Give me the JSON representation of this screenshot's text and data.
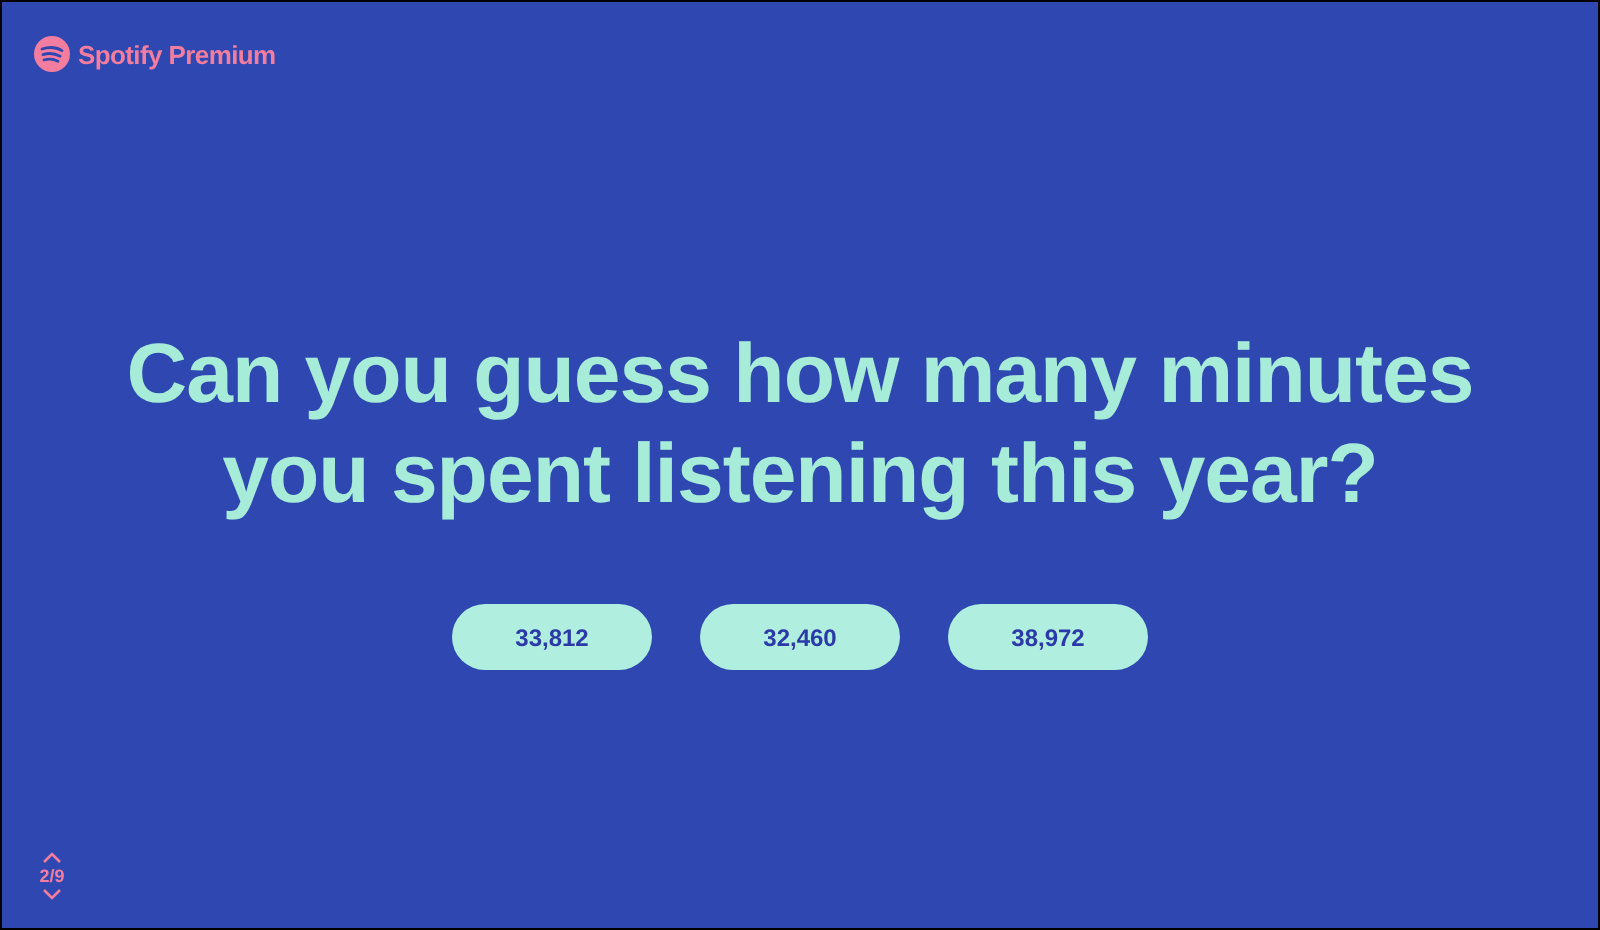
{
  "brand": {
    "name": "Spotify",
    "tier": "Premium"
  },
  "question": "Can you guess how many minutes you spent listening this year?",
  "answers": [
    "33,812",
    "32,460",
    "38,972"
  ],
  "pager": {
    "position": "2/9"
  }
}
